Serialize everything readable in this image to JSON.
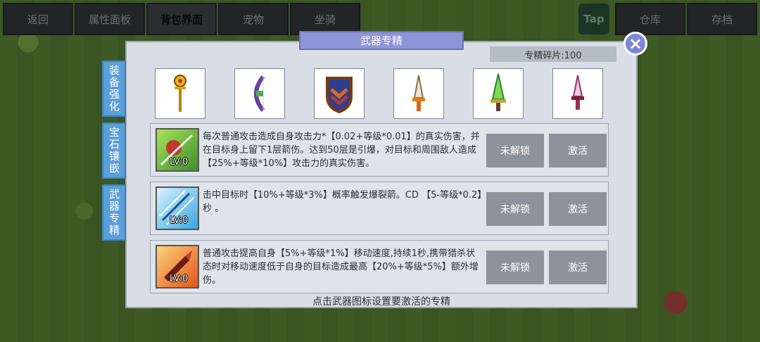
{
  "top_tabs": [
    {
      "label": "返回"
    },
    {
      "label": "属性面板"
    },
    {
      "label": "背包界面"
    },
    {
      "label": "宠物"
    },
    {
      "label": "坐骑"
    }
  ],
  "top_right": {
    "tap_label": "Tap",
    "warehouse_label": "仓库",
    "save_label": "存档"
  },
  "dialog": {
    "title": "武器专精",
    "shards_text": "专精碎片:100",
    "hint": "点击武器图标设置要激活的专精"
  },
  "side_tabs": [
    {
      "label": "装备强化"
    },
    {
      "label": "宝石镶嵌"
    },
    {
      "label": "武器专精"
    }
  ],
  "weapons": [
    {
      "icon": "golden-staff-icon"
    },
    {
      "icon": "purple-bow-icon"
    },
    {
      "icon": "shield-icon"
    },
    {
      "icon": "dagger-icon"
    },
    {
      "icon": "green-sword-icon"
    },
    {
      "icon": "pink-dagger-icon"
    }
  ],
  "skills": [
    {
      "icon": "apple-arrow-icon",
      "level": "LV:0",
      "description": "每次普通攻击造成自身攻击力*【0.02+等级*0.01】的真实伤害，并在目标身上留下1层箭伤。达到50层是引爆，对目标和周围敌人造成【25%+等级*10%】攻击力的真实伤害。",
      "locked_label": "未解锁",
      "activate_label": "激活"
    },
    {
      "icon": "ice-arrows-icon",
      "level": "LV:0",
      "description": "击中目标时【10%+等级*3%】概率触发爆裂箭。CD 【5-等级*0.2】秒 。",
      "locked_label": "未解锁",
      "activate_label": "激活"
    },
    {
      "icon": "fire-blade-icon",
      "level": "LV:0",
      "description": "普通攻击提高自身【5%+等级*1%】移动速度,持续1秒,携带猎杀状态时对移动速度低于自身的目标造成最高【20%+等级*5%】额外增伤。",
      "locked_label": "未解锁",
      "activate_label": "激活"
    }
  ],
  "colors": {
    "title_bg": "#8f93d8",
    "side_tab_bg": "#5b9fd8",
    "button_bg": "#8c939c"
  }
}
